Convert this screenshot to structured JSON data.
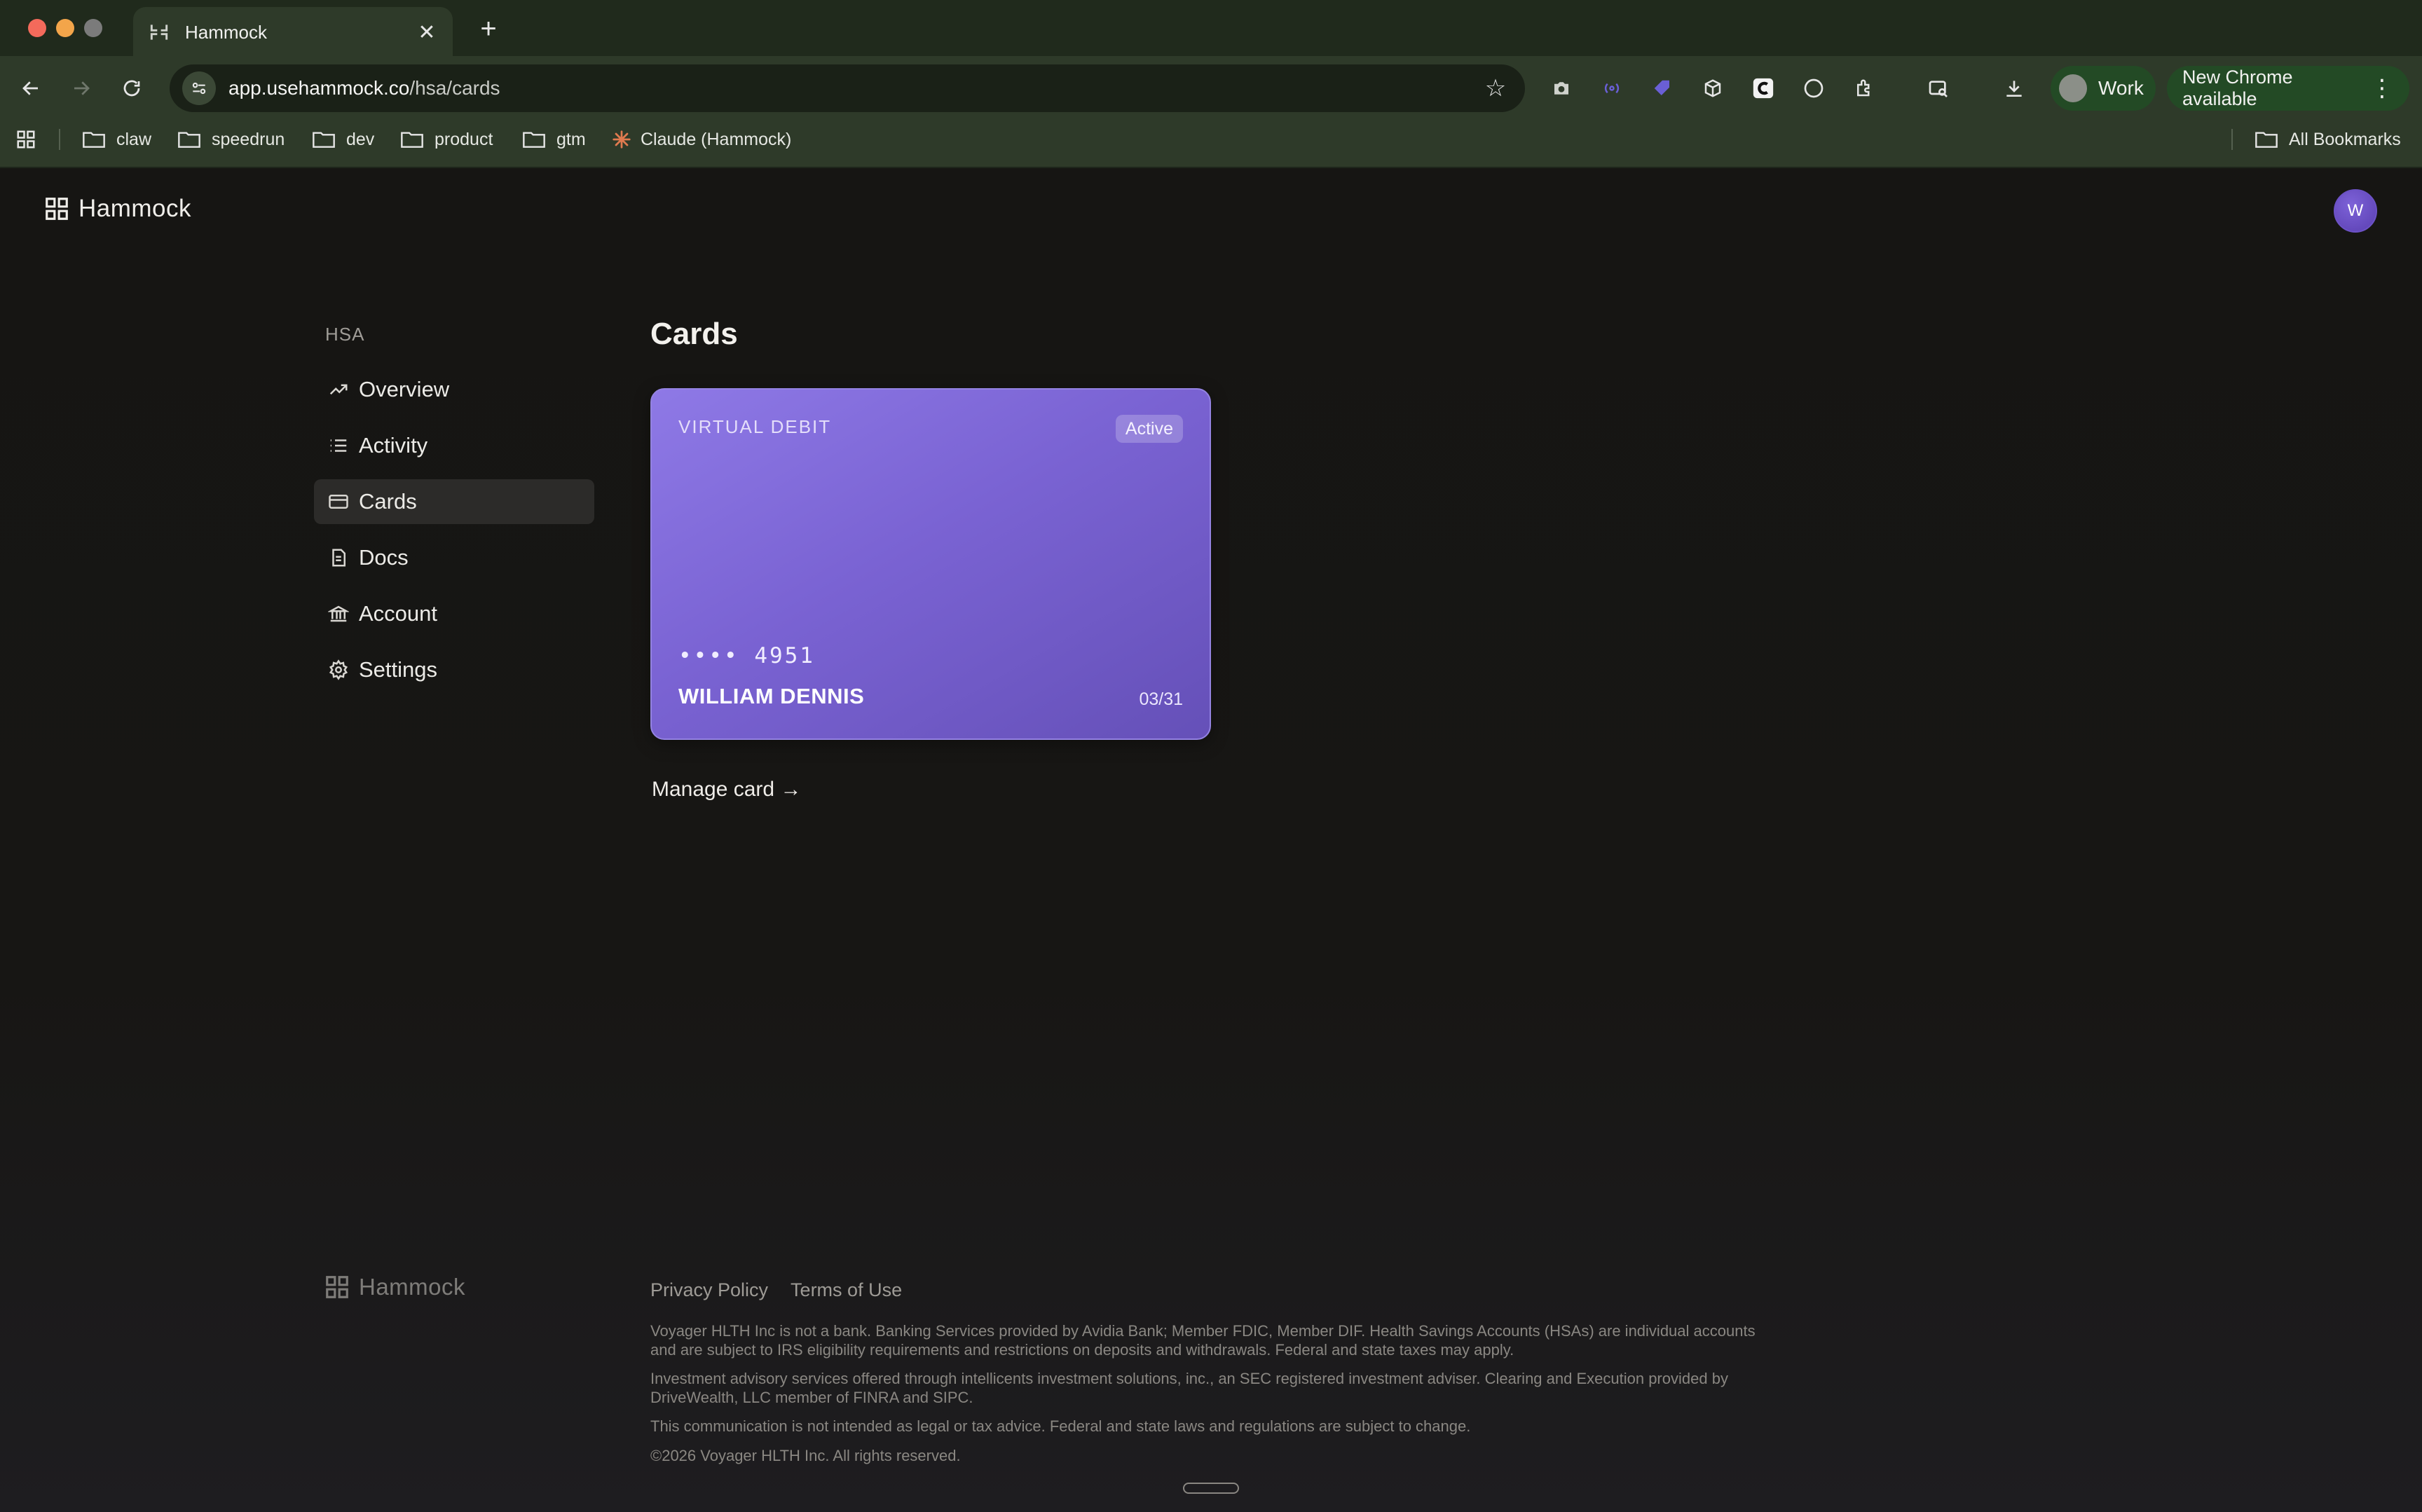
{
  "browser": {
    "tab_title": "Hammock",
    "url_host": "app.usehammock.co",
    "url_path": "/hsa/cards",
    "profile_label": "Work",
    "update_label": "New Chrome available",
    "bookmarks": [
      "claw",
      "speedrun",
      "dev",
      "product",
      "gtm",
      "Claude (Hammock)"
    ],
    "all_bookmarks_label": "All Bookmarks"
  },
  "header": {
    "brand": "Hammock",
    "avatar_initial": "W"
  },
  "sidebar": {
    "section": "HSA",
    "items": [
      {
        "label": "Overview",
        "icon": "trend-up-icon"
      },
      {
        "label": "Activity",
        "icon": "list-icon"
      },
      {
        "label": "Cards",
        "icon": "card-icon",
        "active": true
      },
      {
        "label": "Docs",
        "icon": "document-icon"
      },
      {
        "label": "Account",
        "icon": "bank-icon"
      },
      {
        "label": "Settings",
        "icon": "gear-icon"
      }
    ]
  },
  "main": {
    "title": "Cards",
    "card": {
      "type": "VIRTUAL DEBIT",
      "status": "Active",
      "number": "•••• 4951",
      "holder": "WILLIAM DENNIS",
      "expiry": "03/31"
    },
    "manage_label": "Manage card →"
  },
  "footer": {
    "brand": "Hammock",
    "links": [
      "Privacy Policy",
      "Terms of Use"
    ],
    "legal": [
      "Voyager HLTH Inc is not a bank. Banking Services provided by Avidia Bank; Member FDIC, Member DIF. Health Savings Accounts (HSAs) are individual accounts and are subject to IRS eligibility requirements and restrictions on deposits and withdrawals. Federal and state taxes may apply.",
      "Investment advisory services offered through intellicents investment solutions, inc., an SEC registered investment adviser. Clearing and Execution provided by DriveWealth, LLC member of FINRA and SIPC.",
      "This communication is not intended as legal or tax advice. Federal and state laws and regulations are subject to change.",
      "©2026 Voyager HLTH Inc. All rights reserved."
    ]
  },
  "colors": {
    "accent": "#7a63d3",
    "browser_frame": "#2e3a29",
    "page_bg": "#161513"
  }
}
